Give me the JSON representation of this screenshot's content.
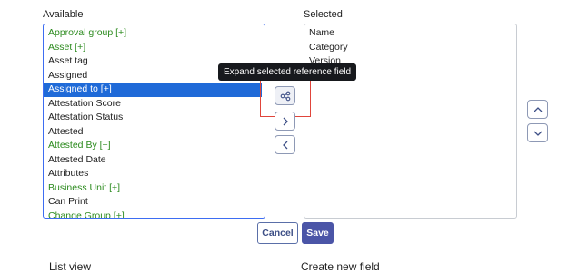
{
  "available": {
    "label": "Available",
    "items": [
      {
        "label": "Approval group [+]",
        "type": "ref"
      },
      {
        "label": "Asset [+]",
        "type": "ref"
      },
      {
        "label": "Asset tag",
        "type": "plain"
      },
      {
        "label": "Assigned",
        "type": "plain"
      },
      {
        "label": "Assigned to [+]",
        "type": "selected"
      },
      {
        "label": "Attestation Score",
        "type": "plain"
      },
      {
        "label": "Attestation Status",
        "type": "plain"
      },
      {
        "label": "Attested",
        "type": "plain"
      },
      {
        "label": "Attested By [+]",
        "type": "ref"
      },
      {
        "label": "Attested Date",
        "type": "plain"
      },
      {
        "label": "Attributes",
        "type": "plain"
      },
      {
        "label": "Business Unit [+]",
        "type": "ref"
      },
      {
        "label": "Can Print",
        "type": "plain"
      },
      {
        "label": "Change Group [+]",
        "type": "ref"
      }
    ]
  },
  "selected": {
    "label": "Selected",
    "items": [
      "Name",
      "Category",
      "Version"
    ]
  },
  "tooltip": "Expand selected reference field",
  "icons": {
    "expand": "hierarchy-icon",
    "add": "chevron-right-icon",
    "remove": "chevron-left-icon",
    "up": "chevron-up-icon",
    "down": "chevron-down-icon"
  },
  "actions": {
    "cancel": "Cancel",
    "save": "Save"
  },
  "footer": {
    "list_view": "List view",
    "create_field": "Create new field"
  },
  "colors": {
    "reference_text": "#2b8a1d",
    "selection_bg": "#1f6ad8",
    "focus_border": "#3d6df2",
    "save_bg": "#4b55a7",
    "tooltip_bg": "#17191d",
    "highlight": "#e0453b"
  }
}
